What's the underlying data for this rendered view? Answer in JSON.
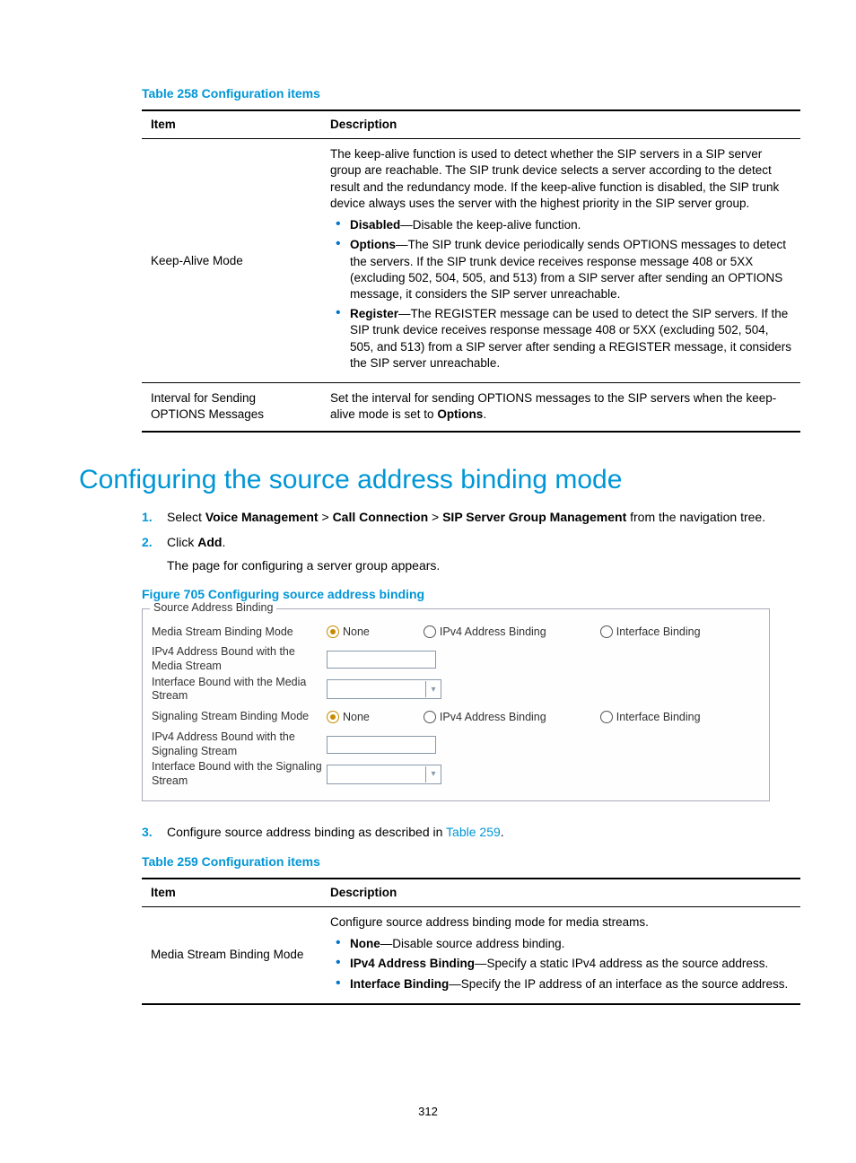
{
  "table258": {
    "caption": "Table 258 Configuration items",
    "headers": {
      "item": "Item",
      "desc": "Description"
    },
    "rows": [
      {
        "item": "Keep-Alive Mode",
        "intro": "The keep-alive function is used to detect whether the SIP servers in a SIP server group are reachable. The SIP trunk device selects a server according to the detect result and the redundancy mode. If the keep-alive function is disabled, the SIP trunk device always uses the server with the highest priority in the SIP server group.",
        "bullets": [
          {
            "term": "Disabled",
            "text": "—Disable the keep-alive function."
          },
          {
            "term": "Options",
            "text": "—The SIP trunk device periodically sends OPTIONS messages to detect the servers. If the SIP trunk device receives response message 408 or 5XX (excluding 502, 504, 505, and 513) from a SIP server after sending an OPTIONS message, it considers the SIP server unreachable."
          },
          {
            "term": "Register",
            "text": "—The REGISTER message can be used to detect the SIP servers. If the SIP trunk device receives response message 408 or 5XX (excluding 502, 504, 505, and 513) from a SIP server after sending a REGISTER message, it considers the SIP server unreachable."
          }
        ]
      },
      {
        "item": "Interval for Sending OPTIONS Messages",
        "plain_pre": "Set the interval for sending OPTIONS messages to the SIP servers when the keep-alive mode is set to ",
        "plain_bold": "Options",
        "plain_post": "."
      }
    ]
  },
  "heading": "Configuring the source address binding mode",
  "steps": [
    {
      "num": "1.",
      "plain_pre": "Select ",
      "b1": "Voice Management",
      "sep1": " > ",
      "b2": "Call Connection",
      "sep2": " > ",
      "b3": "SIP Server Group Management",
      "plain_post": " from the navigation tree."
    },
    {
      "num": "2.",
      "plain_pre": "Click ",
      "b1": "Add",
      "plain_post": ".",
      "sub": "The page for configuring a server group appears."
    },
    {
      "num": "3.",
      "plain_pre": "Configure source address binding as described in ",
      "link": "Table 259",
      "plain_post": "."
    }
  ],
  "figure705": {
    "caption": "Figure 705 Configuring source address binding"
  },
  "form": {
    "legend": "Source Address Binding",
    "rows": {
      "media_mode": {
        "label": "Media Stream Binding Mode",
        "opts": {
          "none": "None",
          "ipv4": "IPv4 Address Binding",
          "iface": "Interface Binding"
        }
      },
      "media_ipv4": {
        "label": "IPv4 Address Bound with the Media Stream"
      },
      "media_iface": {
        "label": "Interface Bound with the Media Stream"
      },
      "sig_mode": {
        "label": "Signaling Stream Binding Mode",
        "opts": {
          "none": "None",
          "ipv4": "IPv4 Address Binding",
          "iface": "Interface Binding"
        }
      },
      "sig_ipv4": {
        "label": "IPv4 Address Bound with the Signaling Stream"
      },
      "sig_iface": {
        "label": "Interface Bound with the Signaling Stream"
      }
    }
  },
  "table259": {
    "caption": "Table 259 Configuration items",
    "headers": {
      "item": "Item",
      "desc": "Description"
    },
    "rows": [
      {
        "item": "Media Stream Binding Mode",
        "intro": "Configure source address binding mode for media streams.",
        "bullets": [
          {
            "term": "None",
            "text": "—Disable source address binding."
          },
          {
            "term": "IPv4 Address Binding",
            "text": "—Specify a static IPv4 address as the source address."
          },
          {
            "term": "Interface Binding",
            "text": "—Specify the IP address of an interface as the source address."
          }
        ]
      }
    ]
  },
  "page_number": "312"
}
